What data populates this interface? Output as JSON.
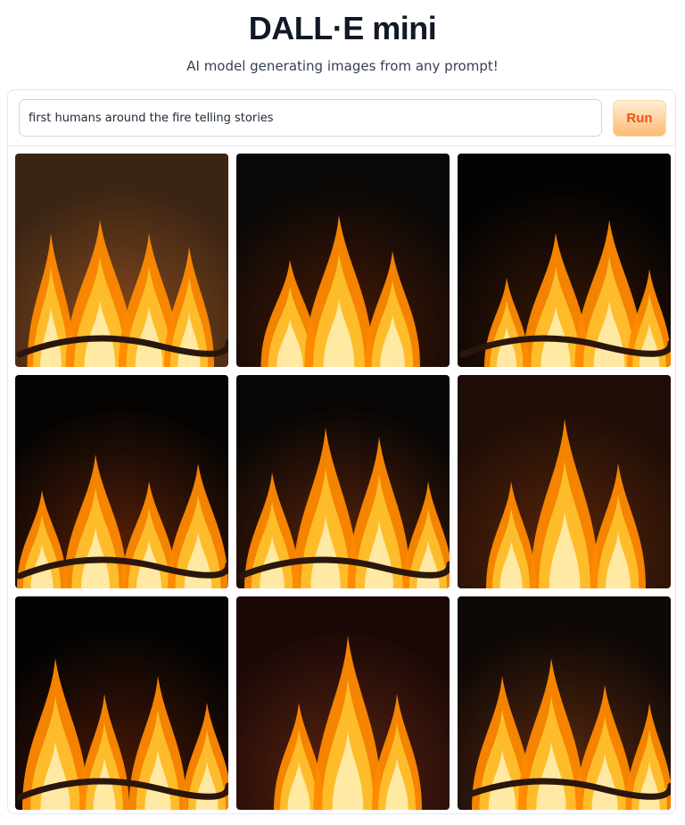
{
  "header": {
    "title": "DALL·E mini",
    "subtitle": "AI model generating images from any prompt!"
  },
  "prompt": {
    "value": "first humans around the fire telling stories"
  },
  "run_button": {
    "label": "Run"
  },
  "gallery": {
    "images": [
      {
        "description": "fire-image",
        "background": "#3a2414",
        "glow": "#8a4b1c",
        "has_log": true
      },
      {
        "description": "fire-image",
        "background": "#0a0806",
        "glow": "#4a1a05",
        "has_log": false
      },
      {
        "description": "fire-image",
        "background": "#030303",
        "glow": "#3a1805",
        "has_log": true
      },
      {
        "description": "fire-image",
        "background": "#050403",
        "glow": "#5a2008",
        "has_log": true
      },
      {
        "description": "fire-image",
        "background": "#080605",
        "glow": "#5c2409",
        "has_log": true
      },
      {
        "description": "fire-image",
        "background": "#1e0d06",
        "glow": "#5a2509",
        "has_log": false
      },
      {
        "description": "fire-image",
        "background": "#030303",
        "glow": "#4a1806",
        "has_log": true
      },
      {
        "description": "fire-image",
        "background": "#1a0806",
        "glow": "#5a2410",
        "has_log": false
      },
      {
        "description": "fire-image",
        "background": "#0e0806",
        "glow": "#5c2a0e",
        "has_log": true
      }
    ]
  },
  "colors": {
    "accent": "#ea580c",
    "flame_outer": "#ff8a00",
    "flame_mid": "#ffc533",
    "flame_core": "#fff4c2"
  }
}
